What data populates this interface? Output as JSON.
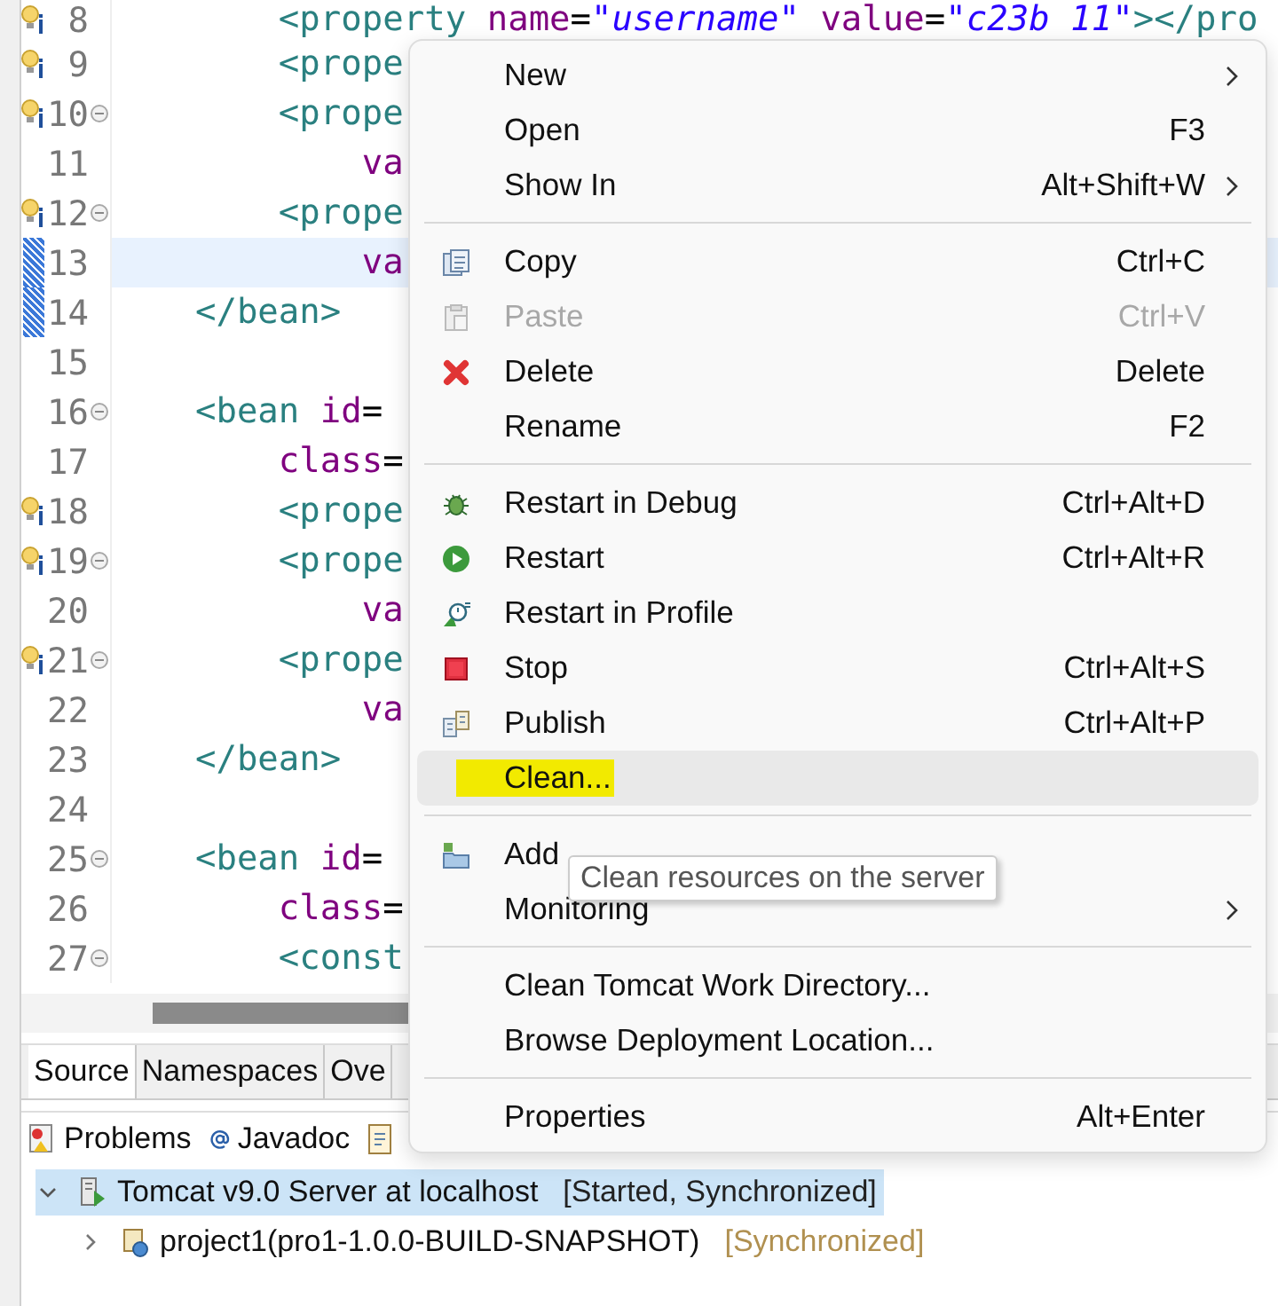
{
  "editor": {
    "lines": [
      {
        "number": "8",
        "kind": "info",
        "fold": false,
        "current": false,
        "segments": [
          {
            "kind": "tag",
            "text": "        <property"
          },
          {
            "kind": "attr",
            "text": " name"
          },
          {
            "kind": "plain",
            "text": "="
          },
          {
            "kind": "string",
            "text": "\"username\""
          },
          {
            "kind": "attr",
            "text": " value"
          },
          {
            "kind": "plain",
            "text": "="
          },
          {
            "kind": "string",
            "text": "\"c23b 11\""
          },
          {
            "kind": "tag",
            "text": "></pro"
          }
        ]
      },
      {
        "number": "9",
        "kind": "info",
        "fold": false,
        "current": false,
        "segments": [
          {
            "kind": "tag",
            "text": "        <prope"
          }
        ]
      },
      {
        "number": "10",
        "kind": "info",
        "fold": true,
        "current": false,
        "segments": [
          {
            "kind": "tag",
            "text": "        <prope"
          }
        ]
      },
      {
        "number": "11",
        "kind": "plain",
        "fold": false,
        "current": false,
        "segments": [
          {
            "kind": "attr",
            "text": "            va"
          }
        ]
      },
      {
        "number": "12",
        "kind": "info",
        "fold": true,
        "current": false,
        "segments": [
          {
            "kind": "tag",
            "text": "        <prope"
          }
        ]
      },
      {
        "number": "13",
        "kind": "changed",
        "fold": false,
        "current": true,
        "segments": [
          {
            "kind": "attr",
            "text": "            va"
          }
        ]
      },
      {
        "number": "14",
        "kind": "changed",
        "fold": false,
        "current": false,
        "segments": [
          {
            "kind": "tag",
            "text": "    </bean>"
          }
        ]
      },
      {
        "number": "15",
        "kind": "plain",
        "fold": false,
        "current": false
      },
      {
        "number": "16",
        "kind": "plain",
        "fold": true,
        "current": false,
        "segments": [
          {
            "kind": "tag",
            "text": "    <bean"
          },
          {
            "kind": "attr",
            "text": " id"
          },
          {
            "kind": "plain",
            "text": "="
          }
        ]
      },
      {
        "number": "17",
        "kind": "plain",
        "fold": false,
        "current": false,
        "segments": [
          {
            "kind": "attr",
            "text": "        class"
          },
          {
            "kind": "plain",
            "text": "="
          }
        ]
      },
      {
        "number": "18",
        "kind": "info",
        "fold": false,
        "current": false,
        "segments": [
          {
            "kind": "tag",
            "text": "        <prope"
          }
        ]
      },
      {
        "number": "19",
        "kind": "info",
        "fold": true,
        "current": false,
        "segments": [
          {
            "kind": "tag",
            "text": "        <prope"
          }
        ]
      },
      {
        "number": "20",
        "kind": "plain",
        "fold": false,
        "current": false,
        "segments": [
          {
            "kind": "attr",
            "text": "            va"
          }
        ]
      },
      {
        "number": "21",
        "kind": "info",
        "fold": true,
        "current": false,
        "segments": [
          {
            "kind": "tag",
            "text": "        <prope"
          }
        ]
      },
      {
        "number": "22",
        "kind": "plain",
        "fold": false,
        "current": false,
        "segments": [
          {
            "kind": "attr",
            "text": "            va"
          }
        ]
      },
      {
        "number": "23",
        "kind": "plain",
        "fold": false,
        "current": false,
        "segments": [
          {
            "kind": "tag",
            "text": "    </bean>"
          }
        ]
      },
      {
        "number": "24",
        "kind": "plain",
        "fold": false,
        "current": false
      },
      {
        "number": "25",
        "kind": "plain",
        "fold": true,
        "current": false,
        "segments": [
          {
            "kind": "tag",
            "text": "    <bean"
          },
          {
            "kind": "attr",
            "text": " id"
          },
          {
            "kind": "plain",
            "text": "="
          }
        ]
      },
      {
        "number": "26",
        "kind": "plain",
        "fold": false,
        "current": false,
        "segments": [
          {
            "kind": "attr",
            "text": "        class"
          },
          {
            "kind": "plain",
            "text": "="
          }
        ]
      },
      {
        "number": "27",
        "kind": "plain",
        "fold": true,
        "current": false,
        "segments": [
          {
            "kind": "tag",
            "text": "        <const"
          }
        ]
      }
    ],
    "tabs": [
      {
        "label": "Source",
        "selected": true
      },
      {
        "label": "Namespaces",
        "selected": false
      },
      {
        "label": "Ove",
        "selected": false
      }
    ]
  },
  "views": {
    "tabs": [
      {
        "kind": "problems",
        "label": "Problems"
      },
      {
        "kind": "javadoc",
        "label": "Javadoc"
      },
      {
        "kind": "declaration"
      }
    ],
    "servers": [
      {
        "kind": "server",
        "label": "Tomcat v9.0 Server at localhost",
        "status": "[Started, Synchronized]",
        "expanded": true,
        "selected": true,
        "children": [
          {
            "kind": "module",
            "label": "project1(pro1-1.0.0-BUILD-SNAPSHOT)",
            "status": "[Synchronized]",
            "expanded": false,
            "selected": false
          }
        ]
      }
    ]
  },
  "context_menu": {
    "items": [
      {
        "kind": "plain",
        "label": "New",
        "submenu": true,
        "disabled": false,
        "selected": false,
        "marked": false
      },
      {
        "kind": "plain",
        "label": "Open",
        "shortcut": "F3",
        "submenu": false,
        "disabled": false,
        "selected": false,
        "marked": false
      },
      {
        "kind": "plain",
        "label": "Show In",
        "shortcut": "Alt+Shift+W",
        "submenu": true,
        "disabled": false,
        "selected": false,
        "marked": false
      },
      {
        "kind": "separator"
      },
      {
        "kind": "copy",
        "label": "Copy",
        "shortcut": "Ctrl+C",
        "submenu": false,
        "disabled": false,
        "selected": false,
        "marked": false
      },
      {
        "kind": "paste",
        "label": "Paste",
        "shortcut": "Ctrl+V",
        "submenu": false,
        "disabled": true,
        "selected": false,
        "marked": false
      },
      {
        "kind": "delete",
        "label": "Delete",
        "shortcut": "Delete",
        "submenu": false,
        "disabled": false,
        "selected": false,
        "marked": false
      },
      {
        "kind": "plain",
        "label": "Rename",
        "shortcut": "F2",
        "submenu": false,
        "disabled": false,
        "selected": false,
        "marked": false
      },
      {
        "kind": "separator"
      },
      {
        "kind": "debug",
        "label": "Restart in Debug",
        "shortcut": "Ctrl+Alt+D",
        "submenu": false,
        "disabled": false,
        "selected": false,
        "marked": false
      },
      {
        "kind": "run",
        "label": "Restart",
        "shortcut": "Ctrl+Alt+R",
        "submenu": false,
        "disabled": false,
        "selected": false,
        "marked": false
      },
      {
        "kind": "profile",
        "label": "Restart in Profile",
        "submenu": false,
        "disabled": false,
        "selected": false,
        "marked": false
      },
      {
        "kind": "stop",
        "label": "Stop",
        "shortcut": "Ctrl+Alt+S",
        "submenu": false,
        "disabled": false,
        "selected": false,
        "marked": false
      },
      {
        "kind": "publish",
        "label": "Publish",
        "shortcut": "Ctrl+Alt+P",
        "submenu": false,
        "disabled": false,
        "selected": false,
        "marked": false
      },
      {
        "kind": "plain",
        "label": "Clean...",
        "submenu": false,
        "disabled": false,
        "selected": true,
        "marked": true
      },
      {
        "kind": "separator"
      },
      {
        "kind": "folder",
        "label": "Add",
        "submenu": false,
        "disabled": false,
        "selected": false,
        "marked": false
      },
      {
        "kind": "plain",
        "label": "Monitoring",
        "submenu": true,
        "disabled": false,
        "selected": false,
        "marked": false
      },
      {
        "kind": "separator"
      },
      {
        "kind": "plain",
        "label": "Clean Tomcat Work Directory...",
        "submenu": false,
        "disabled": false,
        "selected": false,
        "marked": false
      },
      {
        "kind": "plain",
        "label": "Browse Deployment Location...",
        "submenu": false,
        "disabled": false,
        "selected": false,
        "marked": false
      },
      {
        "kind": "separator"
      },
      {
        "kind": "plain",
        "label": "Properties",
        "shortcut": "Alt+Enter",
        "submenu": false,
        "disabled": false,
        "selected": false,
        "marked": false
      }
    ]
  },
  "tooltip": {
    "text": "Clean resources on the server"
  }
}
